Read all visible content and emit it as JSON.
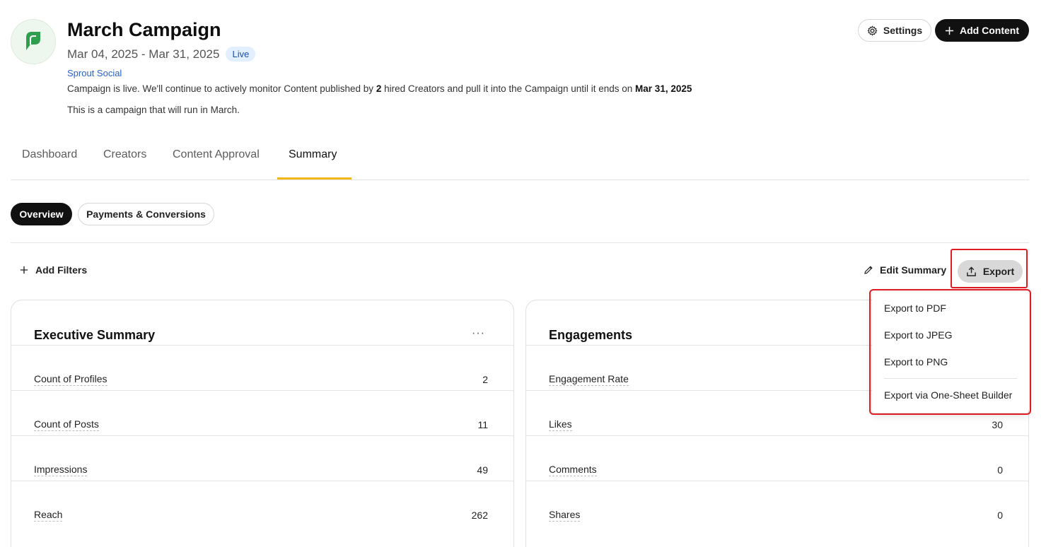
{
  "campaign": {
    "title": "March Campaign",
    "date_range": "Mar 04, 2025 - Mar 31, 2025",
    "status_badge": "Live",
    "organization": "Sprout Social",
    "status_prefix": "Campaign is live. We'll continue to actively monitor Content published by ",
    "creator_count": "2",
    "status_middle": " hired Creators and pull it into the Campaign until it ends on ",
    "end_date": "Mar 31, 2025",
    "description": "This is a campaign that will run in March."
  },
  "header_actions": {
    "settings_label": "Settings",
    "add_content_label": "Add Content"
  },
  "tabs": [
    {
      "label": "Dashboard"
    },
    {
      "label": "Creators"
    },
    {
      "label": "Content Approval"
    },
    {
      "label": "Summary"
    }
  ],
  "subtabs": [
    {
      "label": "Overview"
    },
    {
      "label": "Payments & Conversions"
    }
  ],
  "toolbar": {
    "add_filters_label": "Add Filters",
    "edit_summary_label": "Edit Summary",
    "export_label": "Export"
  },
  "export_menu": [
    {
      "label": "Export to PDF"
    },
    {
      "label": "Export to JPEG"
    },
    {
      "label": "Export to PNG"
    },
    {
      "label": "Export via One-Sheet Builder"
    }
  ],
  "executive_summary": {
    "title": "Executive Summary",
    "menu_glyph": "···",
    "rows": [
      {
        "label": "Count of Profiles",
        "value": "2"
      },
      {
        "label": "Count of Posts",
        "value": "11"
      },
      {
        "label": "Impressions",
        "value": "49"
      },
      {
        "label": "Reach",
        "value": "262"
      }
    ]
  },
  "engagements": {
    "title": "Engagements",
    "rows": [
      {
        "label": "Engagement Rate",
        "value": ""
      },
      {
        "label": "Likes",
        "value": "30"
      },
      {
        "label": "Comments",
        "value": "0"
      },
      {
        "label": "Shares",
        "value": "0"
      }
    ]
  },
  "colors": {
    "accent_underline": "#f2b618",
    "highlight_red": "#e11b22",
    "brand_green": "#2e9e4f",
    "link_blue": "#2a62c9"
  }
}
